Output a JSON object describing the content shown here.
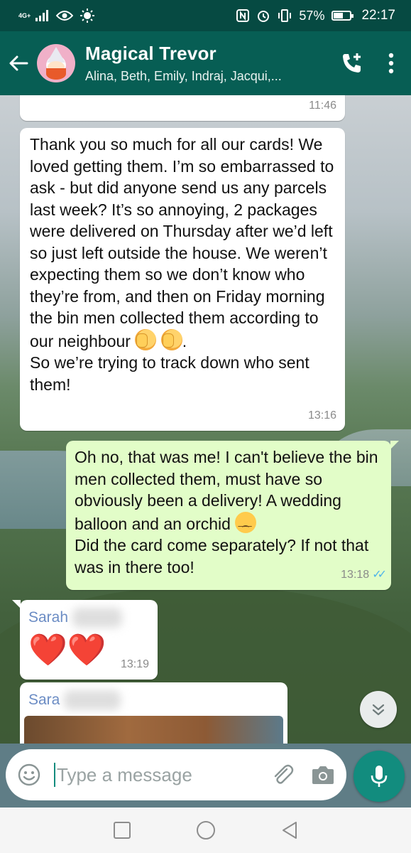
{
  "status_bar": {
    "network_type": "4G+",
    "battery_percent": "57%",
    "battery_level": 0.57,
    "time": "22:17",
    "icons": [
      "signal-icon",
      "eye-icon",
      "brightness-icon",
      "nfc-icon",
      "alarm-icon",
      "vibrate-icon",
      "battery-icon"
    ]
  },
  "header": {
    "title": "Magical Trevor",
    "members": "Alina, Beth, Emily, Indraj, Jacqui,...",
    "icons": [
      "back-arrow-icon",
      "add-call-icon",
      "more-vert-icon"
    ]
  },
  "messages": [
    {
      "direction": "incoming",
      "time": "11:46"
    },
    {
      "direction": "incoming",
      "text_main": "Thank you so much for all our cards! We loved getting them. I’m so embarrassed to ask - but did anyone send us any parcels last week? It’s so annoying, 2 packages were delivered on Thursday after we’d left so just left outside the house. We weren’t expecting them so we don’t know who they’re from, and then on Friday morning the bin men collected them according to our neighbour",
      "text_end": ".",
      "text_second": "So we’re trying to track down who sent them!",
      "emoji": [
        "facepalm-emoji",
        "facepalm-emoji"
      ],
      "time": "13:16"
    },
    {
      "direction": "outgoing",
      "text_main": "Oh no, that was me! I can't believe the bin men collected them, must have so obviously been a delivery! A wedding balloon and an orchid",
      "text_second": "Did the card come separately? If not that was in there too!",
      "emoji": [
        "sad-relieved-emoji"
      ],
      "time": "13:18",
      "status": "read"
    },
    {
      "direction": "incoming",
      "sender": "Sarah",
      "text": "❤️❤️",
      "time": "13:19"
    },
    {
      "direction": "incoming",
      "sender": "Sara",
      "attachment": "image"
    }
  ],
  "composer": {
    "placeholder": "Type a message",
    "icons": [
      "emoji-icon",
      "attach-icon",
      "camera-icon",
      "mic-icon"
    ]
  },
  "nav": {
    "icons": [
      "recent-apps-icon",
      "home-icon",
      "back-icon"
    ]
  },
  "colors": {
    "header_bg": "#075e54",
    "status_bg": "#064a42",
    "outgoing_bubble": "#e2fdc8",
    "incoming_bubble": "#ffffff",
    "accent": "#128c7e",
    "sender_name": "#6b8cc4",
    "read_ticks": "#4fb5ea"
  }
}
